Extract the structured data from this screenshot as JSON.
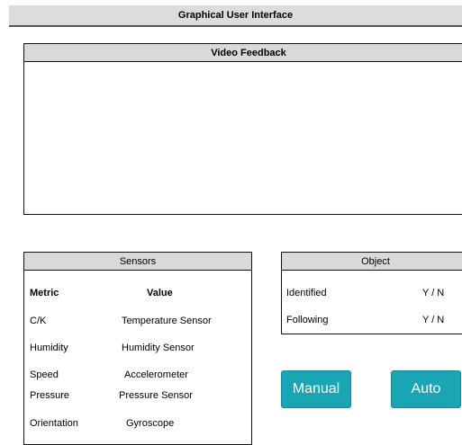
{
  "app_title": "Graphical User Interface",
  "video": {
    "title": "Video Feedback"
  },
  "sensors": {
    "title": "Sensors",
    "header": {
      "metric": "Metric",
      "value": "Value"
    },
    "rows": [
      {
        "metric": "C/K",
        "value": "Temperature Sensor"
      },
      {
        "metric": "Humidity",
        "value": "Humidity Sensor"
      },
      {
        "metric": "Speed",
        "value": "Accelerometer"
      },
      {
        "metric": "Pressure",
        "value": "Pressure Sensor"
      },
      {
        "metric": "Orientation",
        "value": "Gyroscope"
      }
    ]
  },
  "object": {
    "title": "Object",
    "rows": [
      {
        "label": "Identified",
        "value": "Y / N"
      },
      {
        "label": "Following",
        "value": "Y / N"
      }
    ]
  },
  "buttons": {
    "manual": "Manual",
    "auto": "Auto"
  },
  "colors": {
    "button_bg": "#1aa5b5",
    "header_bg": "#d9d9d9"
  }
}
